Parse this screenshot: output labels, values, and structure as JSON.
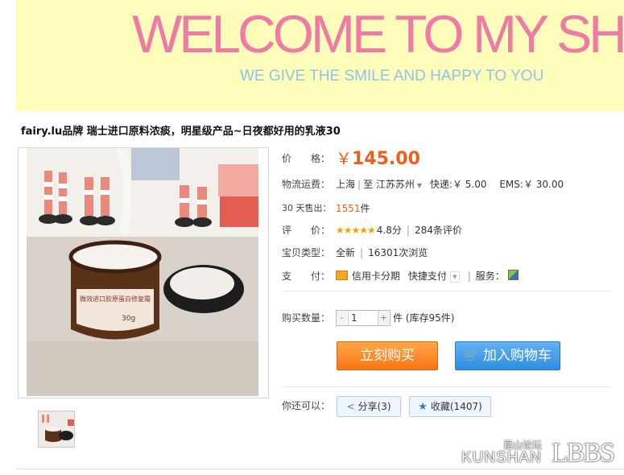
{
  "banner": {
    "title": "WELCOME TO MY SHO",
    "subtitle": "WE GIVE THE SMILE AND HAPPY TO YOU"
  },
  "product": {
    "title": "fairy.lu品牌 瑞士进口原料浓痰，明星级产品~日夜都好用的乳液30",
    "jar_label": "微效进口胶原蛋白修复霜",
    "jar_weight": "30g"
  },
  "details": {
    "price_label": "价　　格：",
    "price_currency": "￥",
    "price_value": "145.00",
    "shipping_label": "物流运费：",
    "ship_from": "上海",
    "ship_to_prefix": "至",
    "ship_to": "江苏苏州",
    "express_label": "快递:",
    "express_price": "￥ 5.00",
    "ems_label": "EMS:",
    "ems_price": "￥ 30.00",
    "sold_label": "30 天售出：",
    "sold_count": "1551",
    "sold_unit": "件",
    "rating_label": "评　　价：",
    "rating_stars": "★★★★★",
    "rating_score": "4.8分",
    "review_count": "284条评价",
    "type_label": "宝贝类型：",
    "type_value": "全新",
    "views": "16301次浏览",
    "pay_label": "支　　付：",
    "pay_credit": "信用卡分期",
    "pay_quick": "快捷支付",
    "service_label": "服务：",
    "qty_label": "购买数量：",
    "qty_minus": "-",
    "qty_value": "1",
    "qty_plus": "+",
    "qty_unit": "件",
    "stock": "(库存95件)"
  },
  "actions": {
    "buy_now": "立刻购买",
    "add_to_cart": "加入购物车",
    "you_can_label": "你还可以：",
    "share_label": "分享",
    "share_count": "(3)",
    "favorite_label": "收藏",
    "favorite_count": "(1407)"
  },
  "watermark": {
    "cn": "昆山论坛",
    "en": "KUNSHAN",
    "bbs": "LBBS"
  },
  "colors": {
    "banner_bg": "#fefdb9",
    "banner_title": "#f07aa6",
    "banner_subtitle": "#8ec3ea",
    "price": "#f25d1a",
    "buy_button": "#f57614",
    "cart_button": "#2f8ee0"
  },
  "icons": [
    "card-icon",
    "dropdown-icon",
    "service-icon",
    "cart-icon",
    "share-icon",
    "star-icon"
  ]
}
